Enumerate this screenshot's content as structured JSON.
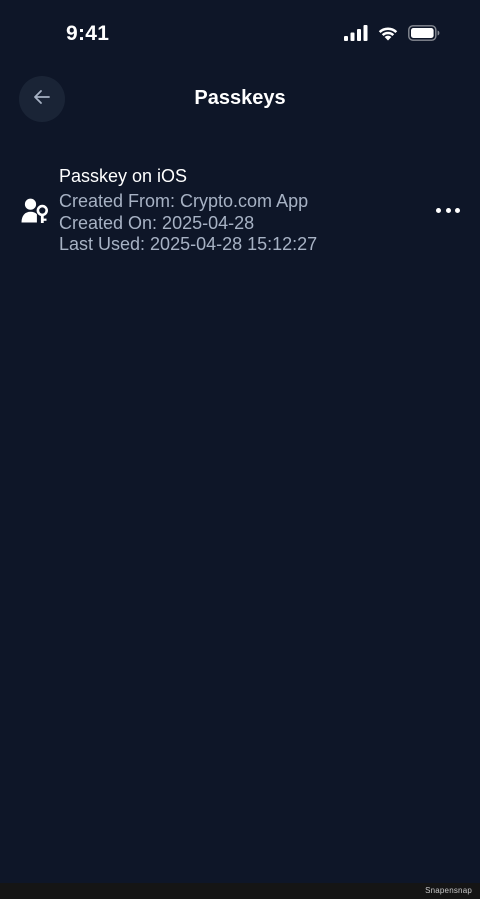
{
  "status_bar": {
    "time": "9:41",
    "icons": [
      "cellular-signal-icon",
      "wifi-icon",
      "battery-icon"
    ]
  },
  "header": {
    "title": "Passkeys",
    "back_icon": "arrow-left-icon"
  },
  "passkeys": [
    {
      "name": "Passkey on iOS",
      "created_from": "Created From: Crypto.com App",
      "created_on": "Created On: 2025-04-28",
      "last_used": "Last Used: 2025-04-28 15:12:27",
      "icon": "user-key-icon",
      "menu_icon": "more-horizontal-icon"
    }
  ],
  "footer": {
    "watermark": "Snapensnap"
  },
  "colors": {
    "background": "#0e1628",
    "back_button_bg": "#1a2436",
    "primary_text": "#ffffff",
    "secondary_text": "#a7b2c4"
  }
}
